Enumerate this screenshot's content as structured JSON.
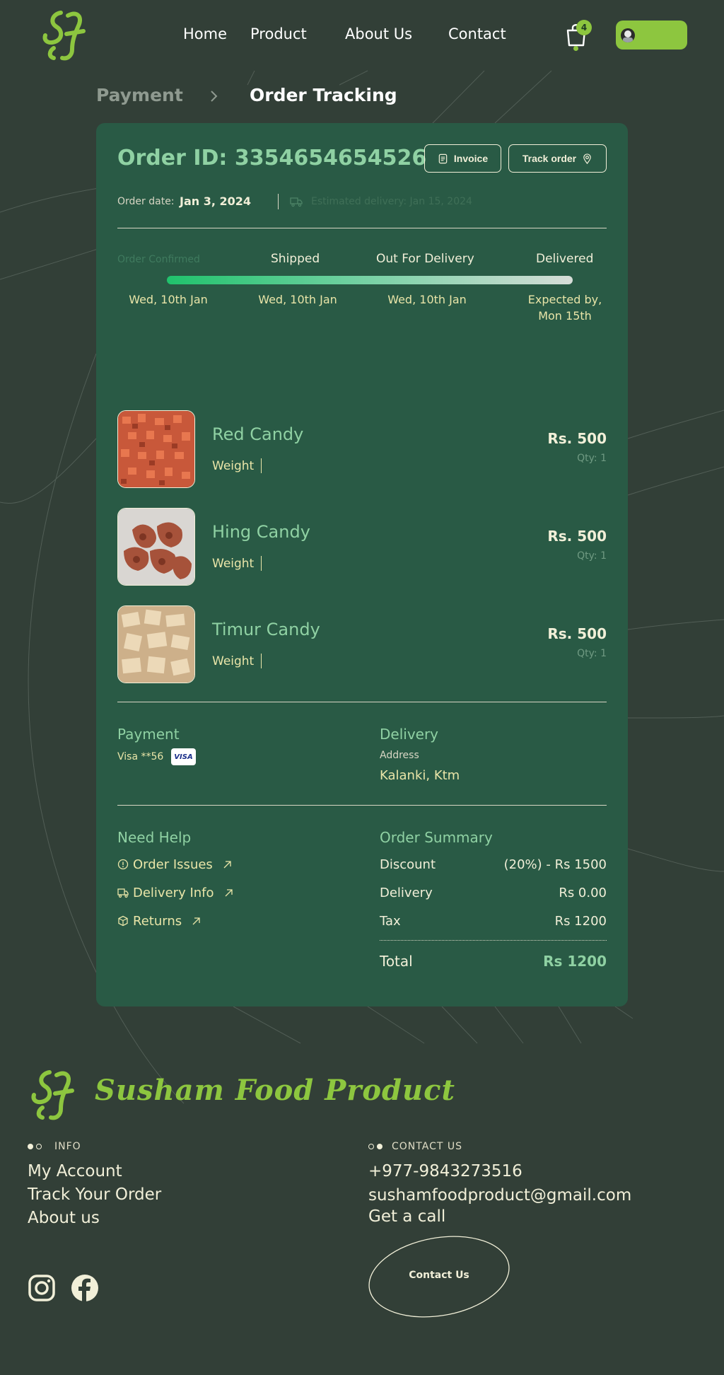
{
  "nav": {
    "items": [
      "Home",
      "Product",
      "About Us",
      "Contact"
    ],
    "cart_count": "4"
  },
  "breadcrumb": {
    "parent": "Payment",
    "current": "Order Tracking"
  },
  "order": {
    "id_label": "Order ID: 3354654654526",
    "invoice_label": "Invoice",
    "track_label": "Track order",
    "date_label": "Order date:",
    "date_value": "Jan 3, 2024",
    "estimated": "Estimated delivery: Jan 15, 2024"
  },
  "tracking": {
    "steps": [
      {
        "label": "Order Confirmed",
        "date": "Wed, 10th Jan"
      },
      {
        "label": "Shipped",
        "date": "Wed, 10th Jan"
      },
      {
        "label": "Out For Delivery",
        "date": "Wed, 10th Jan"
      },
      {
        "label": "Delivered",
        "date": "Expected by, Mon 15th"
      }
    ]
  },
  "items": [
    {
      "name": "Red Candy",
      "weight_label": "Weight",
      "price": "Rs. 500",
      "qty": "Qty: 1"
    },
    {
      "name": "Hing Candy",
      "weight_label": "Weight",
      "price": "Rs. 500",
      "qty": "Qty: 1"
    },
    {
      "name": "Timur Candy",
      "weight_label": "Weight",
      "price": "Rs. 500",
      "qty": "Qty: 1"
    }
  ],
  "payment": {
    "title": "Payment",
    "card": "Visa **56",
    "card_brand": "VISA"
  },
  "delivery": {
    "title": "Delivery",
    "address_label": "Address",
    "address_value": "Kalanki, Ktm"
  },
  "help": {
    "title": "Need Help",
    "links": [
      "Order Issues",
      "Delivery Info",
      "Returns"
    ]
  },
  "summary": {
    "title": "Order Summary",
    "rows": [
      {
        "label": "Discount",
        "value": "(20%) - Rs 1500"
      },
      {
        "label": "Delivery",
        "value": "Rs 0.00"
      },
      {
        "label": "Tax",
        "value": "Rs 1200"
      }
    ],
    "total_label": "Total",
    "total_value": "Rs 1200"
  },
  "footer": {
    "brand": "Susham Food Product",
    "info_heading": "INFO",
    "info_links": [
      "My Account",
      "Track Your Order",
      "About us"
    ],
    "contact_heading": "CONTACT US",
    "phone": "+977-9843273516",
    "email": "sushamfoodproduct@gmail.com",
    "call": "Get a call",
    "contact_button": "Contact Us"
  },
  "colors": {
    "background": "#323f37",
    "card": "#295a45",
    "accent_green": "#8dc63f",
    "mint": "#8fd1a3",
    "cream": "#f1efd8"
  }
}
